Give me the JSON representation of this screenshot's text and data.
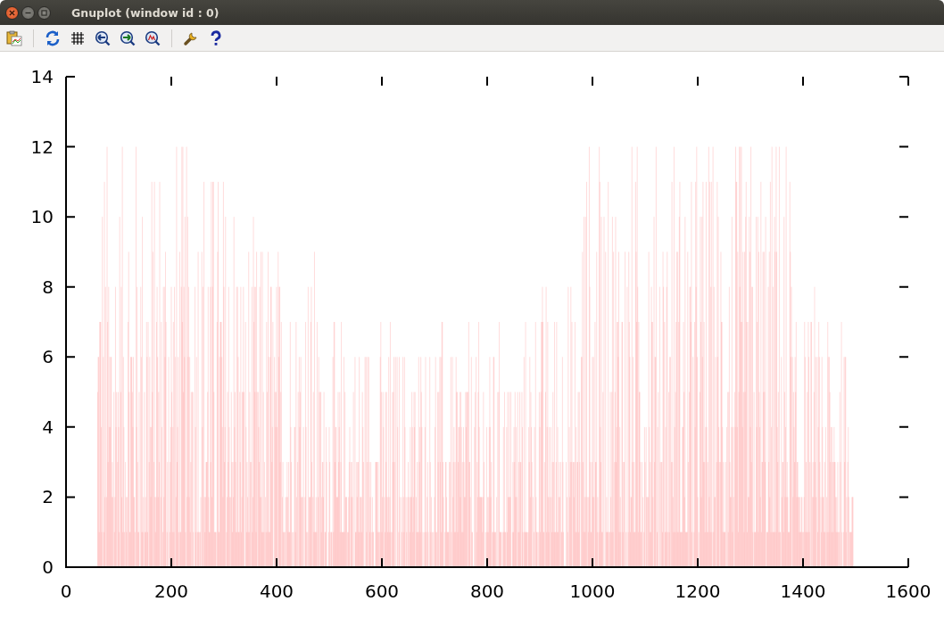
{
  "window": {
    "title": "Gnuplot (window id : 0)"
  },
  "plot": {
    "y_tick_labels": [
      "14",
      "12",
      "10",
      "8",
      "6",
      "4",
      "2",
      "0"
    ],
    "x_tick_labels": [
      "0",
      "200",
      "400",
      "600",
      "800",
      "1000",
      "1200",
      "1400",
      "1600"
    ]
  }
}
